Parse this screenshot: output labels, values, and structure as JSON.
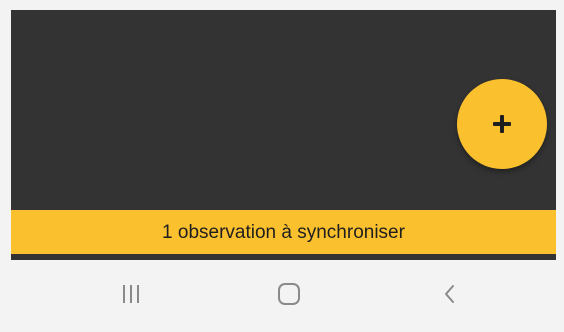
{
  "fab": {
    "icon": "plus-icon",
    "color": "#fbc02d"
  },
  "sync_bar": {
    "label": "1 observation à synchroniser",
    "color": "#fbc02d"
  },
  "nav_bar": {
    "recent_icon": "recent-apps-icon",
    "home_icon": "home-icon",
    "back_icon": "back-icon"
  },
  "colors": {
    "app_background": "#333333",
    "nav_background": "#f3f3f3",
    "nav_icon": "#8a8a8a"
  }
}
